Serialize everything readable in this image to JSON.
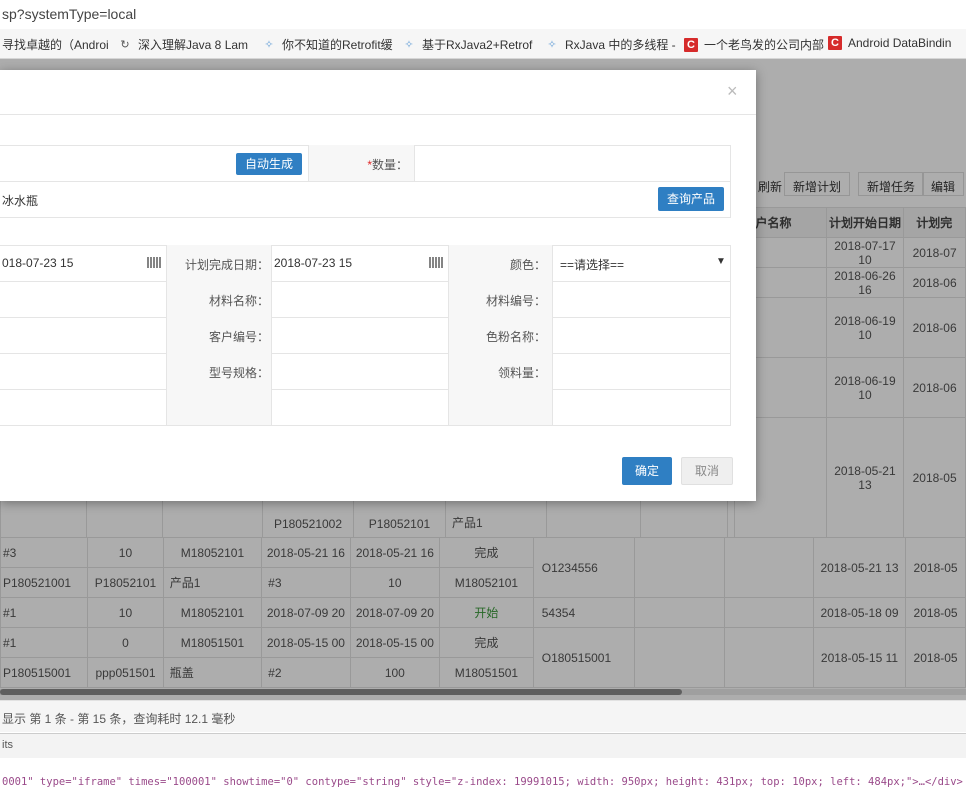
{
  "url": "sp?systemType=local",
  "bookmarks": [
    {
      "icon": "none",
      "label": "寻找卓越的（Androi"
    },
    {
      "icon": "link",
      "label": "深入理解Java 8 Lam"
    },
    {
      "icon": "s",
      "label": "你不知道的Retrofit缓"
    },
    {
      "icon": "s",
      "label": "基于RxJava2+Retrof"
    },
    {
      "icon": "s",
      "label": "RxJava 中的多线程 -"
    },
    {
      "icon": "c",
      "label": "一个老鸟发的公司内部"
    },
    {
      "icon": "c",
      "label": "Android DataBindin"
    }
  ],
  "toolbar": {
    "refresh": "刷新",
    "add_plan": "新增计划",
    "add_task": "新增任务",
    "edit": "编辑"
  },
  "bg_headers": [
    "户名称",
    "计划开始日期",
    "计划完"
  ],
  "bg_right_rows": [
    [
      "",
      "2018-07-17 10",
      "2018-07"
    ],
    [
      "",
      "2018-06-26 16",
      "2018-06"
    ],
    [
      "",
      "2018-06-19 10",
      "2018-06"
    ],
    [
      "",
      "2018-06-19 10",
      "2018-06"
    ],
    [
      "",
      "2018-05-21 13",
      "2018-05"
    ]
  ],
  "bg_partial": {
    "c1": "P180521002",
    "c2": "P18052101",
    "c3": "产品1"
  },
  "bg_rows": [
    [
      "#3",
      "10",
      "M18052101",
      "2018-05-21 16",
      "2018-05-21 16",
      "完成"
    ],
    [
      "P180521001",
      "P18052101",
      "产品1",
      "#3",
      "10",
      "M18052101"
    ],
    [
      "#1",
      "10",
      "M18052101",
      "2018-07-09 20",
      "2018-07-09 20",
      "开始"
    ],
    [
      "#1",
      "0",
      "M18051501",
      "2018-05-15 00",
      "2018-05-15 00",
      "完成"
    ],
    [
      "P180515001",
      "ppp051501",
      "瓶盖",
      "#2",
      "100",
      "M18051501"
    ]
  ],
  "bg_group_cols": [
    {
      "code": "O1234556",
      "date": "2018-05-21 13",
      "end": "2018-05"
    },
    {
      "code": "54354",
      "date": "2018-05-18 09",
      "end": "2018-05"
    },
    {
      "code": "O180515001",
      "date": "2018-05-15 11",
      "end": "2018-05"
    }
  ],
  "status_text": "显示 第 1 条 - 第 15 条，查询耗时 12.1 毫秒",
  "dev_tab": "its",
  "dev_code": "0001\" type=\"iframe\" times=\"100001\" showtime=\"0\" contype=\"string\" style=\"z-index: 19991015; width: 950px; height: 431px; top: 10px; left: 484px;\">…</div>",
  "modal": {
    "close": "×",
    "auto_btn": "自动生成",
    "qty_star": "*",
    "qty_label": "数量：",
    "product_value": "冰水瓶",
    "query_btn": "查询产品",
    "start_date": "018-07-23 15",
    "end_label": "计划完成日期：",
    "end_date": "2018-07-23 15",
    "color_label": "颜色：",
    "color_value": "==请选择==",
    "mat_name_label": "材料名称：",
    "mat_no_label": "材料编号：",
    "cust_no_label": "客户编号：",
    "pigment_label": "色粉名称：",
    "model_label": "型号规格：",
    "pick_qty_label": "领料量：",
    "ok_btn": "确定",
    "cancel_btn": "取消"
  }
}
